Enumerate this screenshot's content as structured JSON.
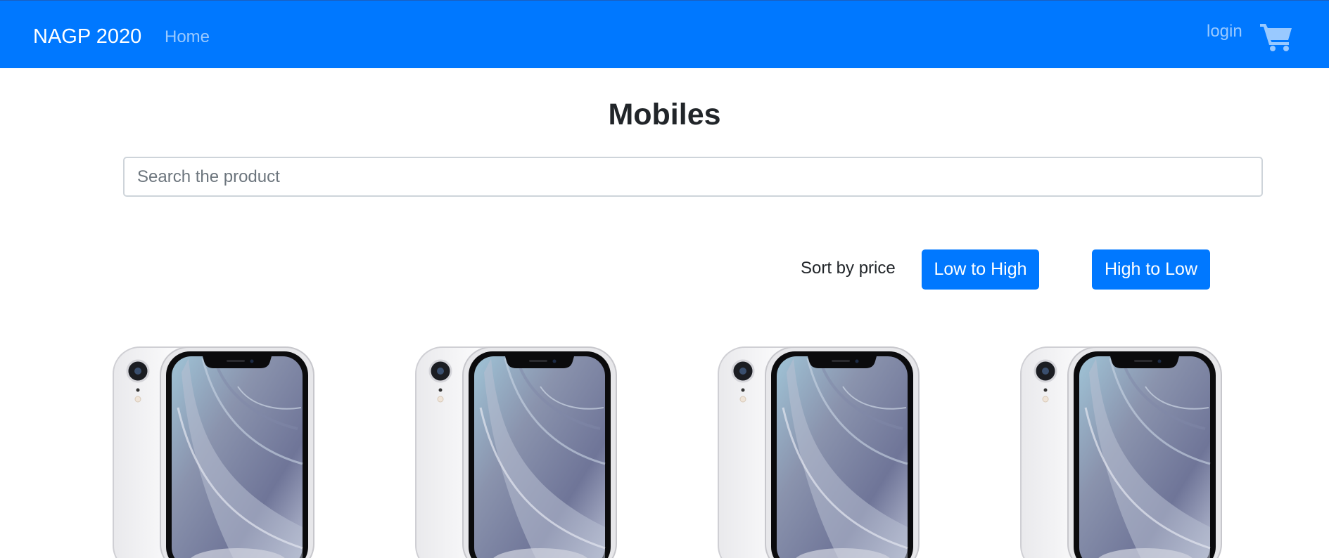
{
  "navbar": {
    "brand": "NAGP 2020",
    "home_label": "Home",
    "login_label": "login",
    "cart_icon": "shopping-cart-icon",
    "background_color": "#0078ff"
  },
  "main": {
    "title": "Mobiles",
    "search": {
      "placeholder": "Search the product",
      "value": ""
    },
    "sort": {
      "label": "Sort by price",
      "low_to_high": "Low to High",
      "high_to_low": "High to Low"
    },
    "products": [
      {
        "image": "iphone-xr-white-image"
      },
      {
        "image": "iphone-xr-white-image"
      },
      {
        "image": "iphone-xr-white-image"
      },
      {
        "image": "iphone-xr-white-image"
      }
    ]
  }
}
